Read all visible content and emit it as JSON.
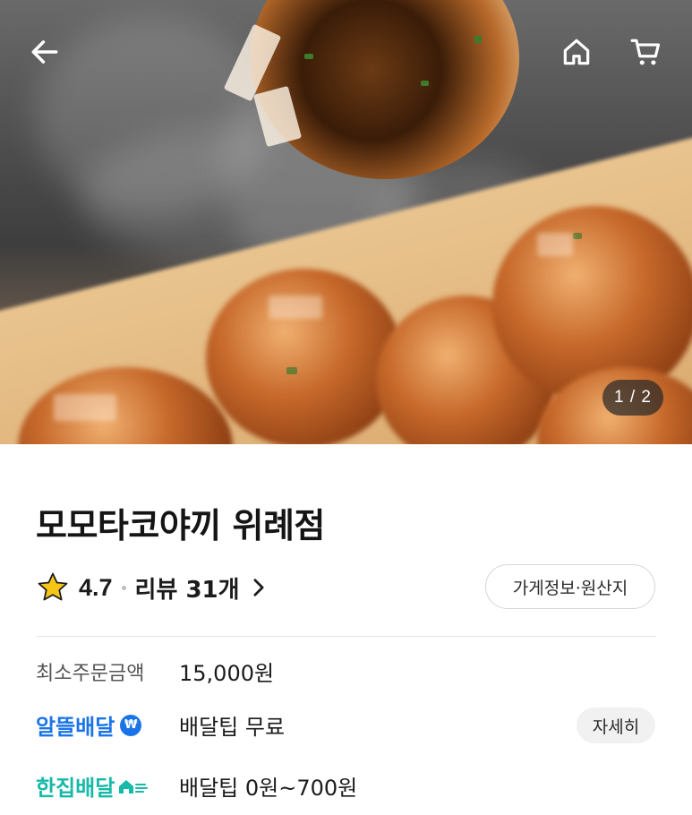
{
  "hero": {
    "page_indicator": "1 / 2"
  },
  "nav": {
    "back_icon": "arrow-left-icon",
    "home_icon": "home-icon",
    "cart_icon": "cart-icon"
  },
  "store": {
    "name": "모모타코야끼 위례점",
    "rating": "4.7",
    "review_label": "리뷰 31개",
    "info_button_label": "가게정보·원산지"
  },
  "details": {
    "min_order_label": "최소주문금액",
    "min_order_value": "15,000원",
    "alddeul_label": "알뜰배달",
    "alddeul_badge": "₩",
    "alddeul_value": "배달팁 무료",
    "detail_button_label": "자세히",
    "hanjip_label": "한집배달",
    "hanjip_value": "배달팁 0원~700원"
  },
  "colors": {
    "alddeul_brand": "#1a74e8",
    "hanjip_brand": "#17b9a8",
    "star": "#f5c518"
  }
}
